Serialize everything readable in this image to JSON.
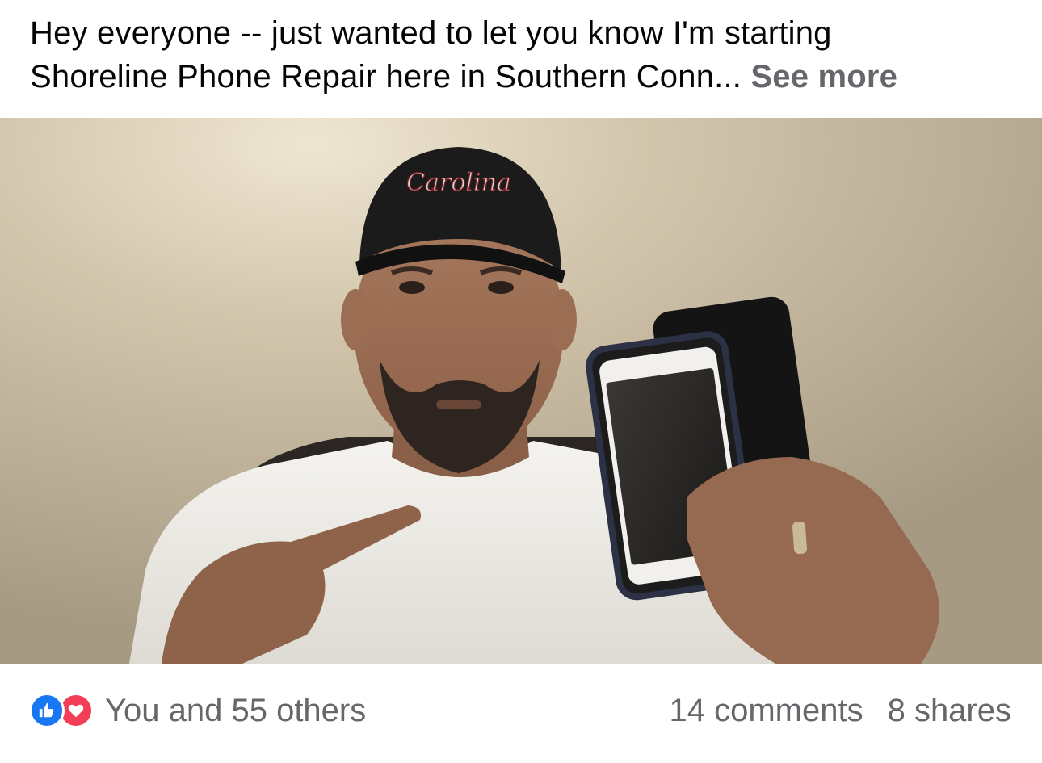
{
  "post": {
    "text_line1": "Hey everyone -- just wanted to let you know I'm starting",
    "text_line2": "Shoreline Phone Repair here in Southern Conn...",
    "see_more": "See more"
  },
  "photo": {
    "cap_text": "Carolina"
  },
  "footer": {
    "reactions_text": "You and 55 others",
    "comments": "14 comments",
    "shares": "8 shares",
    "icons": [
      "like-icon",
      "love-icon"
    ]
  },
  "colors": {
    "secondary_text": "#65676b",
    "like_blue": "#1877f2",
    "love_red": "#f33e58"
  }
}
